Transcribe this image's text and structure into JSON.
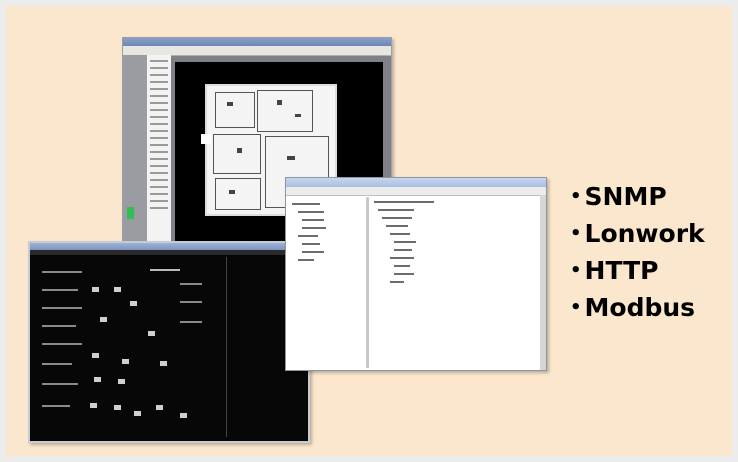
{
  "protocols": {
    "bullet": "•",
    "items": [
      "SNMP",
      "Lonwork",
      "HTTP",
      "Modbus"
    ]
  },
  "windows": {
    "floor_plan": "floor-plan-viewer",
    "schematic": "dark-schematic-viewer",
    "tree": "object-tree-browser"
  },
  "colors": {
    "background": "#fbe7cd",
    "text": "#000000"
  }
}
